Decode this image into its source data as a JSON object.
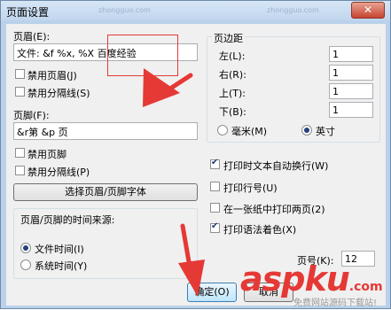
{
  "window": {
    "title": "页面设置",
    "watermark_text": "zhongguo.com",
    "close_label": "✕"
  },
  "header": {
    "label": "页眉(E):",
    "value": "文件: &f  %x, %X 百度经验",
    "no_header_checkbox": {
      "label": "禁用页眉(J)",
      "checked": false
    },
    "no_divider_checkbox": {
      "label": "禁用分隔线(S)",
      "checked": false
    }
  },
  "footer": {
    "label": "页脚(F):",
    "value": "&r第 &p 页",
    "no_footer_checkbox": {
      "label": "禁用页脚",
      "checked": false
    },
    "no_divider_checkbox": {
      "label": "禁用分隔线(P)",
      "checked": false
    }
  },
  "font_button_label": "选择页眉/页脚字体",
  "time_source": {
    "title": "页眉/页脚的时间来源:",
    "options": [
      {
        "label": "文件时间(I)",
        "selected": true
      },
      {
        "label": "系统时间(Y)",
        "selected": false
      }
    ]
  },
  "margins": {
    "title": "页边距",
    "fields": [
      {
        "label": "左(L):",
        "value": "1"
      },
      {
        "label": "右(R):",
        "value": "1"
      },
      {
        "label": "上(T):",
        "value": "1"
      },
      {
        "label": "下(B):",
        "value": "1"
      }
    ],
    "units": [
      {
        "label": "毫米(M)",
        "selected": false
      },
      {
        "label": "英寸",
        "selected": true
      }
    ]
  },
  "options": [
    {
      "label": "打印时文本自动换行(W)",
      "checked": true
    },
    {
      "label": "打印行号(U)",
      "checked": false
    },
    {
      "label": "在一张纸中打印两页(2)",
      "checked": false
    },
    {
      "label": "打印语法着色(X)",
      "checked": true
    }
  ],
  "page_number": {
    "label": "页号(K):",
    "value": "12"
  },
  "buttons": {
    "ok": "确定(O)",
    "cancel": "取消"
  },
  "watermark": {
    "brand": "aspku",
    "suffix": ".com",
    "tagline": "免费网站源码下载站!"
  },
  "colors": {
    "annotation_red": "#e53935",
    "brand_red": "#e53935"
  }
}
